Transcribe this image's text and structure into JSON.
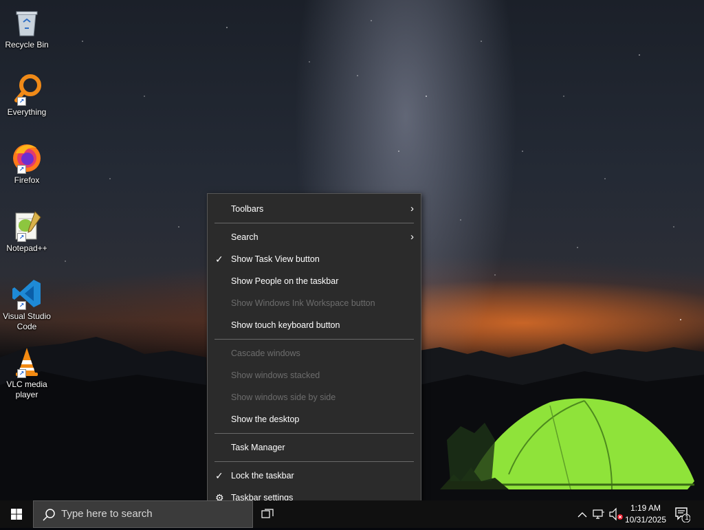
{
  "desktop": {
    "icons": [
      {
        "label": "Recycle Bin",
        "icon": "recycle-bin-icon"
      },
      {
        "label": "Everything",
        "icon": "everything-search-icon"
      },
      {
        "label": "Firefox",
        "icon": "firefox-icon"
      },
      {
        "label": "Notepad++",
        "icon": "notepad-plus-plus-icon"
      },
      {
        "label": "Visual Studio Code",
        "icon": "vscode-icon"
      },
      {
        "label": "VLC media player",
        "icon": "vlc-icon"
      }
    ]
  },
  "context_menu": {
    "items": [
      {
        "label": "Toolbars",
        "submenu": true,
        "enabled": true
      },
      {
        "label": "Search",
        "submenu": true,
        "enabled": true
      },
      {
        "label": "Show Task View button",
        "checked": true,
        "enabled": true
      },
      {
        "label": "Show People on the taskbar",
        "enabled": true
      },
      {
        "label": "Show Windows Ink Workspace button",
        "enabled": false
      },
      {
        "label": "Show touch keyboard button",
        "enabled": true
      },
      {
        "label": "Cascade windows",
        "enabled": false
      },
      {
        "label": "Show windows stacked",
        "enabled": false
      },
      {
        "label": "Show windows side by side",
        "enabled": false
      },
      {
        "label": "Show the desktop",
        "enabled": true
      },
      {
        "label": "Task Manager",
        "enabled": true
      },
      {
        "label": "Lock the taskbar",
        "checked": true,
        "enabled": true
      },
      {
        "label": "Taskbar settings",
        "icon": "gear-icon",
        "enabled": true
      }
    ]
  },
  "taskbar": {
    "search_placeholder": "Type here to search",
    "clock_time": "1:19 AM",
    "clock_date": "10/31/2025",
    "notification_count": "1"
  },
  "colors": {
    "menu_bg": "#2b2b2b",
    "taskbar_bg": "#101010",
    "disabled_text": "#6d6d6d",
    "tent_green": "#8fe33a"
  }
}
